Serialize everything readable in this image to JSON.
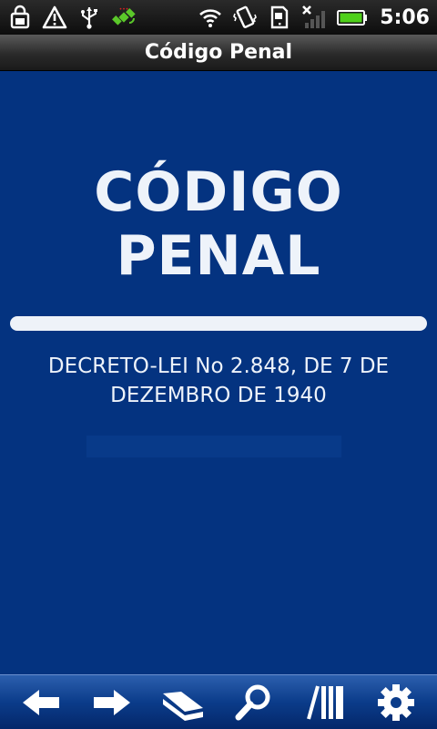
{
  "status_bar": {
    "time": "5:06",
    "icons_left": [
      "shopping-bag-icon",
      "warning-icon",
      "usb-icon",
      "satellite-icon"
    ],
    "icons_right": [
      "wifi-icon",
      "vibrate-icon",
      "sd-card-icon",
      "no-signal-icon",
      "battery-icon"
    ]
  },
  "app_title": "Código Penal",
  "content": {
    "heading": "CÓDIGO PENAL",
    "subtitle": "DECRETO-LEI No 2.848, DE 7 DE DEZEMBRO DE 1940"
  },
  "toolbar": {
    "buttons": [
      "back-arrow-icon",
      "forward-arrow-icon",
      "book-icon",
      "search-icon",
      "library-icon",
      "settings-gear-icon"
    ]
  },
  "colors": {
    "content_bg": "#043380",
    "text": "#eef3fa",
    "battery": "#4fd11a"
  }
}
